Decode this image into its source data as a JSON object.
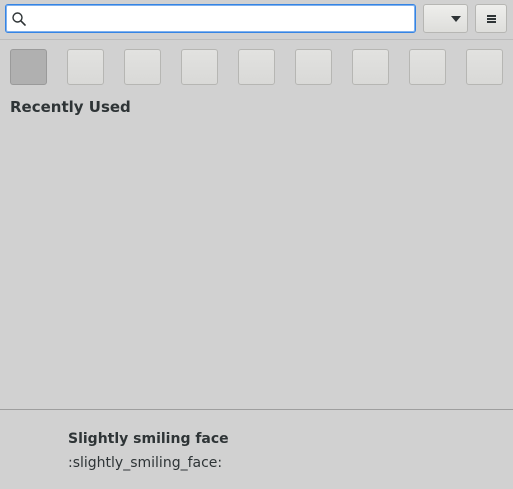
{
  "search": {
    "value": "",
    "placeholder": ""
  },
  "icons": {
    "search": "search-icon",
    "dropdown": "chevron-down-icon",
    "menu": "hamburger-menu-icon"
  },
  "categories": [
    {
      "id": "recently-used",
      "active": true
    },
    {
      "id": "category-2",
      "active": false
    },
    {
      "id": "category-3",
      "active": false
    },
    {
      "id": "category-4",
      "active": false
    },
    {
      "id": "category-5",
      "active": false
    },
    {
      "id": "category-6",
      "active": false
    },
    {
      "id": "category-7",
      "active": false
    },
    {
      "id": "category-8",
      "active": false
    },
    {
      "id": "category-9",
      "active": false
    }
  ],
  "section": {
    "title": "Recently Used"
  },
  "footer": {
    "name": "Slightly smiling face",
    "code": ":slightly_smiling_face:"
  },
  "colors": {
    "background": "#d1d1d1",
    "accent": "#3584e4",
    "text": "#2e3436"
  }
}
